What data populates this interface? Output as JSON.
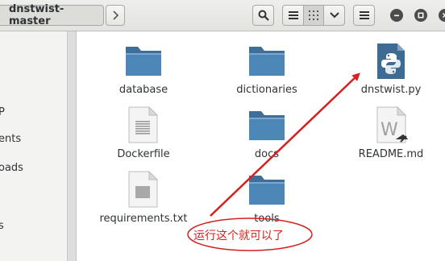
{
  "header": {
    "path_label": "dnstwist-master"
  },
  "sidebar": {
    "items": [
      {
        "label": "P"
      },
      {
        "label": "ents"
      },
      {
        "label": "oads"
      },
      {
        "label": "s"
      }
    ]
  },
  "files": [
    {
      "name": "database",
      "icon": "folder-icon"
    },
    {
      "name": "dictionaries",
      "icon": "folder-icon"
    },
    {
      "name": "dnstwist.py",
      "icon": "python-file-icon"
    },
    {
      "name": "Dockerfile",
      "icon": "text-file-icon"
    },
    {
      "name": "docs",
      "icon": "folder-icon"
    },
    {
      "name": "README.md",
      "icon": "markdown-file-icon"
    },
    {
      "name": "requirements.txt",
      "icon": "text-file-icon"
    },
    {
      "name": "tools",
      "icon": "folder-icon"
    }
  ],
  "annotation": {
    "text": "运行这个就可以了",
    "color": "#d62020"
  },
  "colors": {
    "folder_body": "#4d87b8",
    "folder_tab": "#3f6f99",
    "python_file": "#3d6b93",
    "header_bg": "#e6e6e3"
  }
}
